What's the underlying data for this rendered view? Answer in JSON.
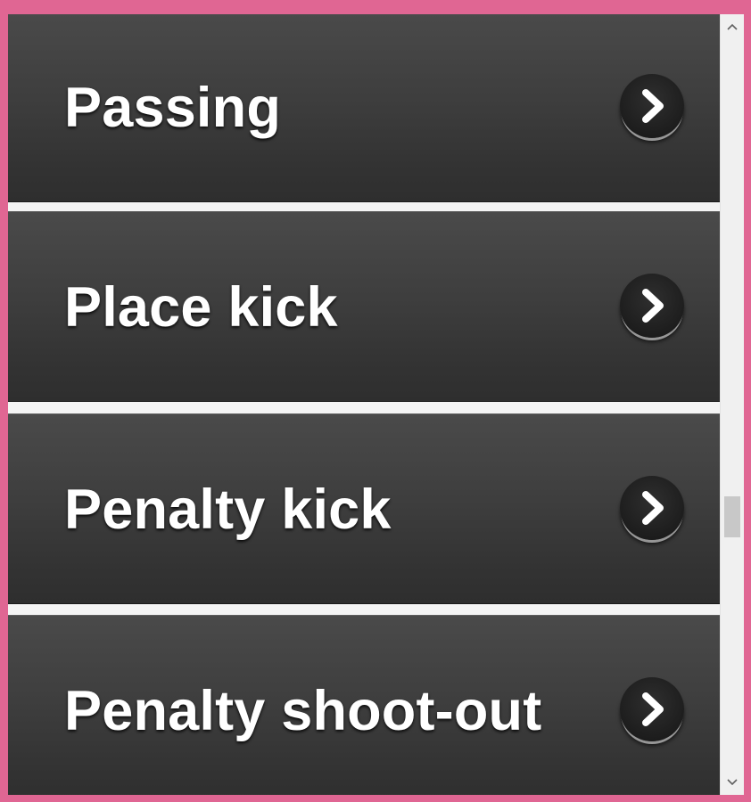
{
  "menu": {
    "items": [
      {
        "label": "Passing",
        "icon": "chevron-right-icon"
      },
      {
        "label": "Place kick",
        "icon": "chevron-right-icon"
      },
      {
        "label": "Penalty kick",
        "icon": "chevron-right-icon"
      },
      {
        "label": "Penalty shoot-out",
        "icon": "chevron-right-icon"
      }
    ]
  },
  "colors": {
    "frame": "#e06693",
    "item_background": "#3e3e3e",
    "separator": "#f4f4f4",
    "text": "#ffffff"
  },
  "scrollbar": {
    "up_icon": "chevron-up-icon",
    "down_icon": "chevron-down-icon"
  }
}
